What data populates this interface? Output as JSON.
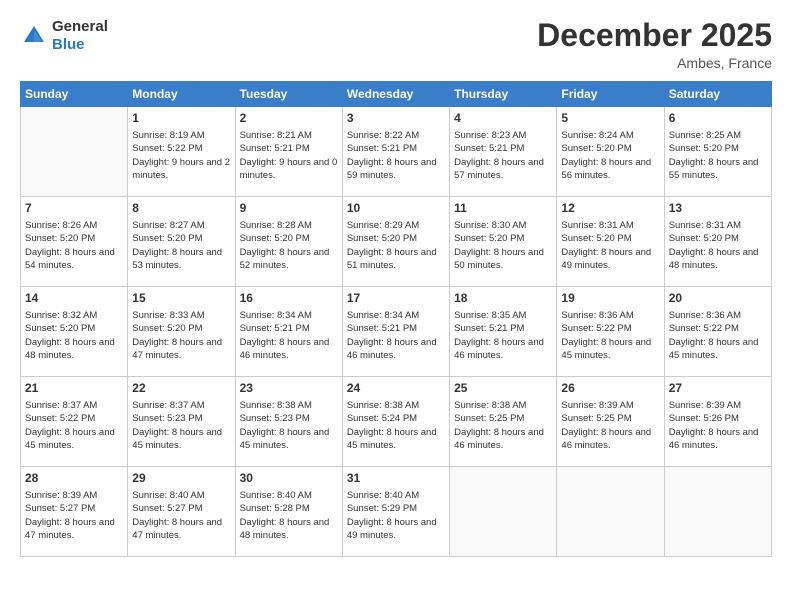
{
  "logo": {
    "general": "General",
    "blue": "Blue"
  },
  "header": {
    "month": "December 2025",
    "location": "Ambes, France"
  },
  "weekdays": [
    "Sunday",
    "Monday",
    "Tuesday",
    "Wednesday",
    "Thursday",
    "Friday",
    "Saturday"
  ],
  "weeks": [
    [
      {
        "day": null,
        "info": null
      },
      {
        "day": "1",
        "sunrise": "8:19 AM",
        "sunset": "5:22 PM",
        "daylight": "9 hours and 2 minutes."
      },
      {
        "day": "2",
        "sunrise": "8:21 AM",
        "sunset": "5:21 PM",
        "daylight": "9 hours and 0 minutes."
      },
      {
        "day": "3",
        "sunrise": "8:22 AM",
        "sunset": "5:21 PM",
        "daylight": "8 hours and 59 minutes."
      },
      {
        "day": "4",
        "sunrise": "8:23 AM",
        "sunset": "5:21 PM",
        "daylight": "8 hours and 57 minutes."
      },
      {
        "day": "5",
        "sunrise": "8:24 AM",
        "sunset": "5:20 PM",
        "daylight": "8 hours and 56 minutes."
      },
      {
        "day": "6",
        "sunrise": "8:25 AM",
        "sunset": "5:20 PM",
        "daylight": "8 hours and 55 minutes."
      }
    ],
    [
      {
        "day": "7",
        "sunrise": "8:26 AM",
        "sunset": "5:20 PM",
        "daylight": "8 hours and 54 minutes."
      },
      {
        "day": "8",
        "sunrise": "8:27 AM",
        "sunset": "5:20 PM",
        "daylight": "8 hours and 53 minutes."
      },
      {
        "day": "9",
        "sunrise": "8:28 AM",
        "sunset": "5:20 PM",
        "daylight": "8 hours and 52 minutes."
      },
      {
        "day": "10",
        "sunrise": "8:29 AM",
        "sunset": "5:20 PM",
        "daylight": "8 hours and 51 minutes."
      },
      {
        "day": "11",
        "sunrise": "8:30 AM",
        "sunset": "5:20 PM",
        "daylight": "8 hours and 50 minutes."
      },
      {
        "day": "12",
        "sunrise": "8:31 AM",
        "sunset": "5:20 PM",
        "daylight": "8 hours and 49 minutes."
      },
      {
        "day": "13",
        "sunrise": "8:31 AM",
        "sunset": "5:20 PM",
        "daylight": "8 hours and 48 minutes."
      }
    ],
    [
      {
        "day": "14",
        "sunrise": "8:32 AM",
        "sunset": "5:20 PM",
        "daylight": "8 hours and 48 minutes."
      },
      {
        "day": "15",
        "sunrise": "8:33 AM",
        "sunset": "5:20 PM",
        "daylight": "8 hours and 47 minutes."
      },
      {
        "day": "16",
        "sunrise": "8:34 AM",
        "sunset": "5:21 PM",
        "daylight": "8 hours and 46 minutes."
      },
      {
        "day": "17",
        "sunrise": "8:34 AM",
        "sunset": "5:21 PM",
        "daylight": "8 hours and 46 minutes."
      },
      {
        "day": "18",
        "sunrise": "8:35 AM",
        "sunset": "5:21 PM",
        "daylight": "8 hours and 46 minutes."
      },
      {
        "day": "19",
        "sunrise": "8:36 AM",
        "sunset": "5:22 PM",
        "daylight": "8 hours and 45 minutes."
      },
      {
        "day": "20",
        "sunrise": "8:36 AM",
        "sunset": "5:22 PM",
        "daylight": "8 hours and 45 minutes."
      }
    ],
    [
      {
        "day": "21",
        "sunrise": "8:37 AM",
        "sunset": "5:22 PM",
        "daylight": "8 hours and 45 minutes."
      },
      {
        "day": "22",
        "sunrise": "8:37 AM",
        "sunset": "5:23 PM",
        "daylight": "8 hours and 45 minutes."
      },
      {
        "day": "23",
        "sunrise": "8:38 AM",
        "sunset": "5:23 PM",
        "daylight": "8 hours and 45 minutes."
      },
      {
        "day": "24",
        "sunrise": "8:38 AM",
        "sunset": "5:24 PM",
        "daylight": "8 hours and 45 minutes."
      },
      {
        "day": "25",
        "sunrise": "8:38 AM",
        "sunset": "5:25 PM",
        "daylight": "8 hours and 46 minutes."
      },
      {
        "day": "26",
        "sunrise": "8:39 AM",
        "sunset": "5:25 PM",
        "daylight": "8 hours and 46 minutes."
      },
      {
        "day": "27",
        "sunrise": "8:39 AM",
        "sunset": "5:26 PM",
        "daylight": "8 hours and 46 minutes."
      }
    ],
    [
      {
        "day": "28",
        "sunrise": "8:39 AM",
        "sunset": "5:27 PM",
        "daylight": "8 hours and 47 minutes."
      },
      {
        "day": "29",
        "sunrise": "8:40 AM",
        "sunset": "5:27 PM",
        "daylight": "8 hours and 47 minutes."
      },
      {
        "day": "30",
        "sunrise": "8:40 AM",
        "sunset": "5:28 PM",
        "daylight": "8 hours and 48 minutes."
      },
      {
        "day": "31",
        "sunrise": "8:40 AM",
        "sunset": "5:29 PM",
        "daylight": "8 hours and 49 minutes."
      },
      {
        "day": null,
        "info": null
      },
      {
        "day": null,
        "info": null
      },
      {
        "day": null,
        "info": null
      }
    ]
  ]
}
